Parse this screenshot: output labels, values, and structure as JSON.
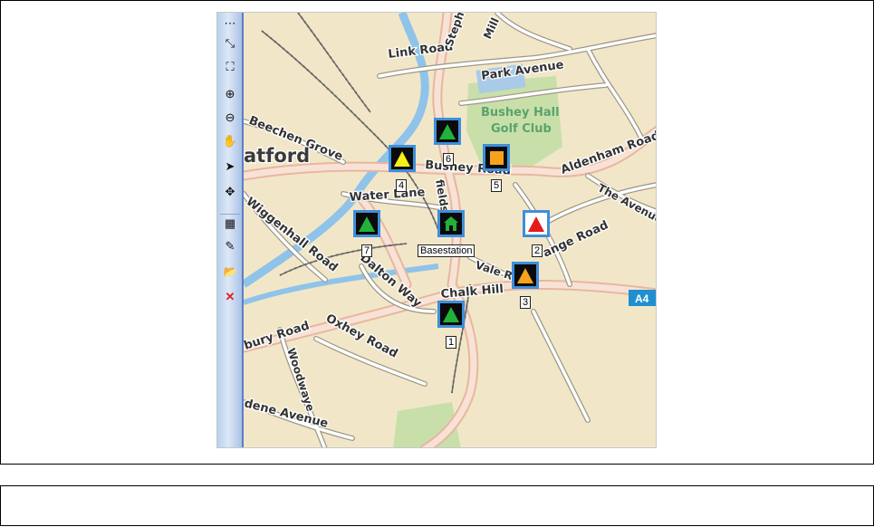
{
  "map": {
    "place_labels": {
      "link_road": "Link Road",
      "park_avenue": "Park  Avenue",
      "golf_line1": "Bushey Hall",
      "golf_line2": "Golf Club",
      "beechen_grove": "Beechen Grove",
      "watford": "atford",
      "bushey_road": "Bushey Road",
      "aldenham_road": "Aldenham Road",
      "the_avenue": "The Avenue",
      "water_lane": "Water Lane",
      "fields": "fields",
      "grange_road": "ange Road",
      "wiggenhall_road": "Wiggenhall Road",
      "dalton_way": "Dalton Way",
      "vale_road": "Vale Rd",
      "chalk_hill": "Chalk Hill",
      "bury_road": "bury Road",
      "oxhey_road": "Oxhey Road",
      "woodwaye": "Woodwaye",
      "dene_avenue": "dene Avenue",
      "stephens": "Steph",
      "mill": "Mill",
      "a4": "A4"
    },
    "markers": [
      {
        "id": "1",
        "label": "1",
        "shape": "triangle",
        "color": "#22b23a"
      },
      {
        "id": "2",
        "label": "2",
        "shape": "triangle",
        "color": "#e31c1c"
      },
      {
        "id": "3",
        "label": "3",
        "shape": "triangle",
        "color": "#f7a21b"
      },
      {
        "id": "4",
        "label": "4",
        "shape": "triangle",
        "color": "#f7ee16"
      },
      {
        "id": "5",
        "label": "5",
        "shape": "square",
        "color": "#f7a21b"
      },
      {
        "id": "6",
        "label": "6",
        "shape": "triangle",
        "color": "#22b23a"
      },
      {
        "id": "7",
        "label": "7",
        "shape": "triangle",
        "color": "#22b23a"
      },
      {
        "id": "base",
        "label": "Basestation",
        "shape": "house",
        "color": "#22b23a"
      }
    ]
  },
  "toolbar": {
    "tools": [
      {
        "name": "more-icon",
        "glyph": "⋯"
      },
      {
        "name": "zoom-to-fit-icon",
        "glyph": "⤡"
      },
      {
        "name": "full-extent-icon",
        "glyph": "⛶"
      },
      {
        "name": "zoom-in-icon",
        "glyph": "⊕"
      },
      {
        "name": "zoom-out-icon",
        "glyph": "⊖"
      },
      {
        "name": "pan-hand-icon",
        "glyph": "✋"
      },
      {
        "name": "select-arrow-icon",
        "glyph": "➤"
      },
      {
        "name": "move-icon",
        "glyph": "✥"
      },
      {
        "name": "layers-icon",
        "glyph": "▦"
      },
      {
        "name": "eraser-icon",
        "glyph": "✎"
      },
      {
        "name": "open-folder-icon",
        "glyph": "📂"
      },
      {
        "name": "delete-icon",
        "glyph": "✕"
      }
    ]
  }
}
